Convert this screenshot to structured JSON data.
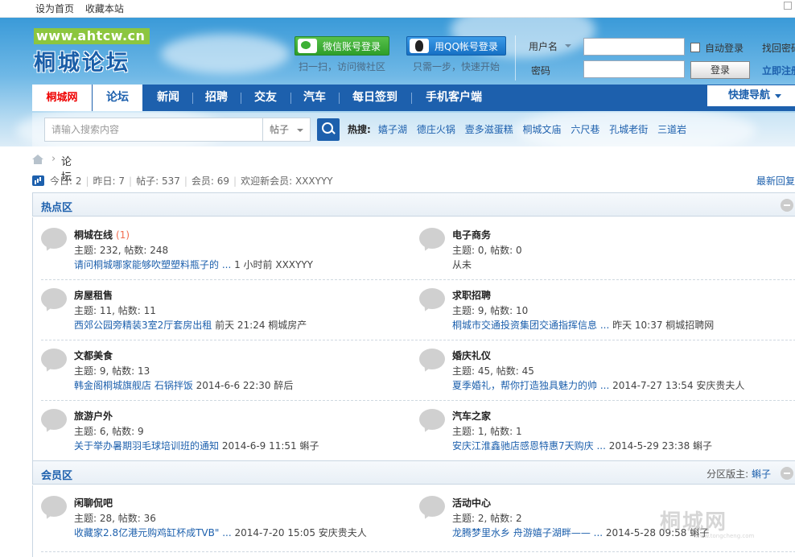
{
  "topbar": {
    "links": [
      "设为首页",
      "收藏本站"
    ]
  },
  "header": {
    "logo_url": "www.ahtcw.cn",
    "logo_name": "桐城论坛",
    "wechat_login": "微信账号登录",
    "wechat_sub": "扫一扫，访问微社区",
    "qq_login": "用QQ帐号登录",
    "qq_sub": "只需一步，快速开始",
    "username_label": "用户名",
    "password_label": "密码",
    "auto_login": "自动登录",
    "login_button": "登录",
    "find_password": "找回密码",
    "register": "立即注册"
  },
  "nav": {
    "items": [
      "桐城网",
      "论坛",
      "新闻",
      "招聘",
      "交友",
      "汽车",
      "每日签到",
      "手机客户端"
    ],
    "quick_nav": "快捷导航"
  },
  "search": {
    "placeholder": "请输入搜索内容",
    "type": "帖子",
    "hot_label": "热搜:",
    "hot": [
      "嬉子湖",
      "德庄火锅",
      "壹多滋蛋糕",
      "桐城文庙",
      "六尺巷",
      "孔城老街",
      "三道岩"
    ]
  },
  "breadcrumb": {
    "current": "论坛",
    "arrow": "›"
  },
  "stats": {
    "today": "今日: 2",
    "yesterday": "昨日: 7",
    "posts": "帖子: 537",
    "members": "会员: 69",
    "welcome": "欢迎新会员: XXXYYY",
    "latest": "最新回复"
  },
  "sections": [
    {
      "title": "热点区",
      "moderator_label": "",
      "moderator": "",
      "forums": [
        {
          "name": "桐城在线",
          "new": "(1)",
          "counts": "主题: 232, 帖数: 248",
          "last_link": "请问桐城哪家能够吹塑塑料瓶子的 ...",
          "last_meta": " 1 小时前 XXXYYY"
        },
        {
          "name": "电子商务",
          "new": "",
          "counts": "主题: 0, 帖数: 0",
          "last_link": "",
          "last_meta": "从未"
        },
        {
          "name": "房屋租售",
          "new": "",
          "counts": "主题: 11, 帖数: 11",
          "last_link": "西郊公园旁精装3室2厅套房出租",
          "last_meta": " 前天 21:24 桐城房产"
        },
        {
          "name": "求职招聘",
          "new": "",
          "counts": "主题: 9, 帖数: 10",
          "last_link": "桐城市交通投资集团交通指挥信息 ...",
          "last_meta": " 昨天 10:37 桐城招聘网"
        },
        {
          "name": "文都美食",
          "new": "",
          "counts": "主题: 9, 帖数: 13",
          "last_link": "韩金阁桐城旗舰店 石锅拌饭",
          "last_meta": " 2014-6-6 22:30 醉后"
        },
        {
          "name": "婚庆礼仪",
          "new": "",
          "counts": "主题: 45, 帖数: 45",
          "last_link": "夏季婚礼，帮你打造独具魅力的帅 ...",
          "last_meta": " 2014-7-27 13:54 安庆贵夫人"
        },
        {
          "name": "旅游户外",
          "new": "",
          "counts": "主题: 6, 帖数: 9",
          "last_link": "关于举办暑期羽毛球培训班的通知",
          "last_meta": " 2014-6-9 11:51 蝌子"
        },
        {
          "name": "汽车之家",
          "new": "",
          "counts": "主题: 1, 帖数: 1",
          "last_link": "安庆江淮鑫驰店感恩特惠7天购庆 ...",
          "last_meta": " 2014-5-29 23:38 蝌子"
        }
      ]
    },
    {
      "title": "会员区",
      "moderator_label": "分区版主: ",
      "moderator": "蝌子",
      "forums": [
        {
          "name": "闲聊侃吧",
          "new": "",
          "counts": "主题: 28, 帖数: 36",
          "last_link": "收藏家2.8亿港元购鸡缸杯成TVB\" ...",
          "last_meta": " 2014-7-20 15:05 安庆贵夫人"
        },
        {
          "name": "活动中心",
          "new": "",
          "counts": "主题: 2, 帖数: 2",
          "last_link": "龙腾梦里水乡 舟游嬉子湖畔—— ...",
          "last_meta": " 2014-5-28 09:58 蝌子"
        }
      ]
    }
  ],
  "watermark": {
    "name": "桐城网",
    "url": "www.tongcheng.com"
  },
  "colors": {
    "nav": "#1d60ad",
    "link": "#1d60ad",
    "home_red": "#e00000",
    "wechat": "#2e9e2a",
    "qq": "#1670c4"
  },
  "icons": [
    "wechat-icon",
    "qq-penguin-icon",
    "search-icon",
    "home-icon",
    "stats-bars-icon",
    "forum-bubble-icon",
    "collapse-icon",
    "chevron-down-icon"
  ]
}
